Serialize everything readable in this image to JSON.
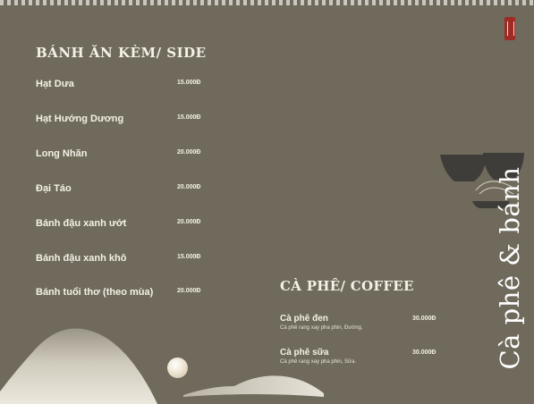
{
  "side_section": {
    "title": "BÁNH ĂN KÈM/ SIDE",
    "items": [
      {
        "name": "Hạt Dưa",
        "price": "15.000Đ"
      },
      {
        "name": "Hạt Hướng Dương",
        "price": "15.000Đ"
      },
      {
        "name": "Long Nhãn",
        "price": "20.000Đ"
      },
      {
        "name": "Đại Táo",
        "price": "20.000Đ"
      },
      {
        "name": "Bánh đậu xanh ướt",
        "price": "20.000Đ"
      },
      {
        "name": "Bánh đậu xanh khô",
        "price": "15.000Đ"
      },
      {
        "name": "Bánh tuổi thơ (theo mùa)",
        "price": "20.000Đ"
      }
    ]
  },
  "coffee_section": {
    "title": "CÀ PHÊ/ COFFEE",
    "items": [
      {
        "name": "Cà phê đen",
        "desc": "Cà phê rang xay pha phin, Đường.",
        "price": "30.000Đ"
      },
      {
        "name": "Cà phê sữa",
        "desc": "Cà phê rang xay pha phin, Sữa.",
        "price": "30.000Đ"
      }
    ]
  },
  "vertical_title": "Cà phê & bánh",
  "colors": {
    "background": "#6f6a5b",
    "text": "#f5f1e7",
    "logo": "#9e2b25",
    "bowl": "#3f3d3a"
  }
}
